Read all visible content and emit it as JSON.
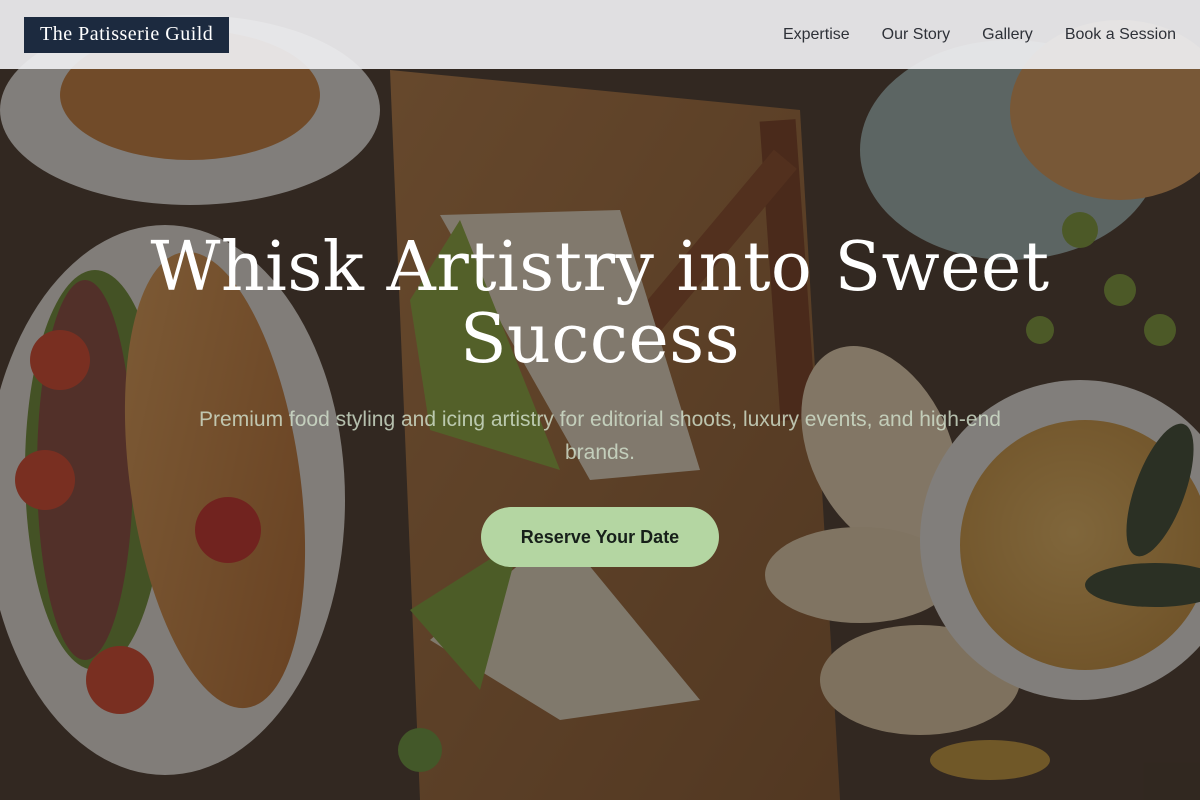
{
  "header": {
    "brand": "The Patisserie Guild",
    "nav": [
      {
        "label": "Expertise"
      },
      {
        "label": "Our Story"
      },
      {
        "label": "Gallery"
      },
      {
        "label": "Book a Session"
      }
    ]
  },
  "hero": {
    "title": "Whisk Artistry into Sweet Success",
    "subtitle": "Premium food styling and icing artistry for editorial shoots, luxury events, and high-end brands.",
    "cta_label": "Reserve Your Date"
  },
  "colors": {
    "brand_bg": "#1c2a3f",
    "cta_bg": "#b4d6a2",
    "nav_bg": "#eeeef0",
    "subtitle": "#d2e0cc"
  }
}
